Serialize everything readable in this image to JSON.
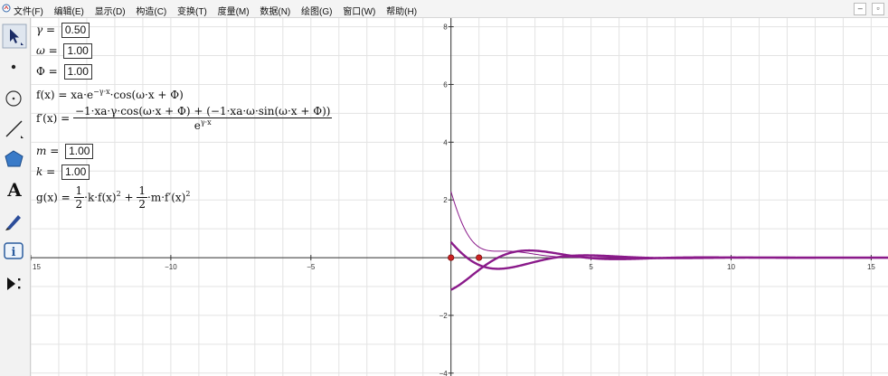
{
  "menubar": {
    "items": [
      "文件(F)",
      "编辑(E)",
      "显示(D)",
      "构造(C)",
      "变换(T)",
      "度量(M)",
      "数据(N)",
      "绘图(G)",
      "窗口(W)",
      "帮助(H)"
    ],
    "min_label": "–",
    "restore_label": "▫"
  },
  "toolbar": {
    "tools": [
      "arrow-select-tool",
      "point-tool",
      "compass-tool",
      "straightedge-tool",
      "polygon-tool",
      "text-tool",
      "marker-tool",
      "information-tool",
      "custom-tool"
    ],
    "text_tool_label": "A"
  },
  "params": {
    "gamma": {
      "name": "γ",
      "eq": " = ",
      "value": "0.50"
    },
    "omega": {
      "name": "ω",
      "eq": " = ",
      "value": "1.00"
    },
    "phi": {
      "name": "Φ",
      "eq": " = ",
      "value": "1.00"
    },
    "f_def": "f(x) = xa·e^(−γ·x)·cos(ω·x + Φ)",
    "f_lhs": "f(x) = xa·e",
    "f_exp": "−γ·x",
    "f_rhs": "·cos(ω·x + Φ)",
    "fprime_lhs": "f′(x) = ",
    "fprime_num": "−1·xa·γ·cos(ω·x + Φ) + (−1·xa·ω·sin(ω·x + Φ))",
    "fprime_den_base": "e",
    "fprime_den_exp": "γ·x",
    "m": {
      "name": "m",
      "eq": " = ",
      "value": "1.00"
    },
    "k": {
      "name": "k",
      "eq": " = ",
      "value": "1.00"
    },
    "g_lhs": "g(x) = ",
    "g_half": "1",
    "g_two": "2",
    "g_term1": "·k·f(x)",
    "g_plus": " + ",
    "g_term2": "·m·f′(x)",
    "g_sq": "2"
  },
  "graph": {
    "x_ticks": [
      "15",
      "−10",
      "−5",
      "5",
      "10",
      "15"
    ],
    "x_tick_values": [
      -15,
      -10,
      -5,
      5,
      10,
      15
    ],
    "y_ticks": [
      "8",
      "6",
      "4",
      "2",
      "−2",
      "−4"
    ],
    "y_tick_values": [
      8,
      6,
      4,
      2,
      -2,
      -4
    ],
    "xlim": [
      -15,
      15.6
    ],
    "ylim": [
      -4.1,
      8.3
    ],
    "axis_color": "#333333",
    "grid_color": "#e3e3e3",
    "curve_color": "#8a1a8a",
    "point_color": "#cc2222",
    "points": [
      [
        0,
        0
      ],
      [
        1,
        0
      ]
    ],
    "params": {
      "gamma": 0.5,
      "omega": 1.0,
      "phi": 1.0,
      "a": 1.0,
      "m": 1.0,
      "k": 1.0
    }
  },
  "colors": {
    "menubar_bg": "#f4f4f4",
    "toolbar_bg": "#f2f2f2",
    "canvas_bg": "#ffffff"
  }
}
